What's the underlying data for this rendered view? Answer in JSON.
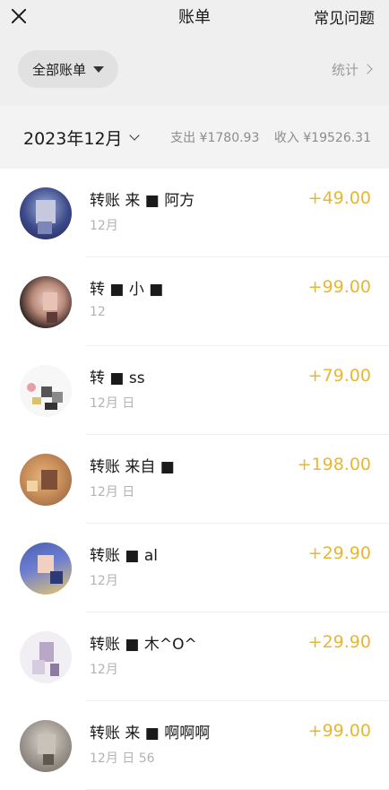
{
  "header": {
    "title": "账单",
    "faq_label": "常见问题",
    "close_icon": "close-icon"
  },
  "filter": {
    "dropdown_label": "全部账单",
    "stats_label": "统计"
  },
  "month": {
    "label": "2023年12月",
    "expense": "支出 ¥1780.93",
    "income": "收入 ¥19526.31"
  },
  "colors": {
    "income_amount": "#e6b732",
    "header_bg": "#efefef",
    "month_bar_bg": "#f3f3f3"
  },
  "transactions": [
    {
      "title": "转账 来 ■ 阿方",
      "date": "12月",
      "amount": "+49.00"
    },
    {
      "title": "转 ■ 小 ■",
      "date": "12",
      "amount": "+99.00"
    },
    {
      "title": "转 ■ ss",
      "date": "12月 日",
      "amount": "+79.00"
    },
    {
      "title": "转账 来自 ■",
      "date": "12月 日",
      "amount": "+198.00"
    },
    {
      "title": "转账 ■ al",
      "date": "12月",
      "amount": "+29.90"
    },
    {
      "title": "转账 ■ 木^O^",
      "date": "12月",
      "amount": "+29.90"
    },
    {
      "title": "转账 来 ■ 啊啊啊",
      "date": "12月 日 56",
      "amount": "+99.00"
    }
  ]
}
